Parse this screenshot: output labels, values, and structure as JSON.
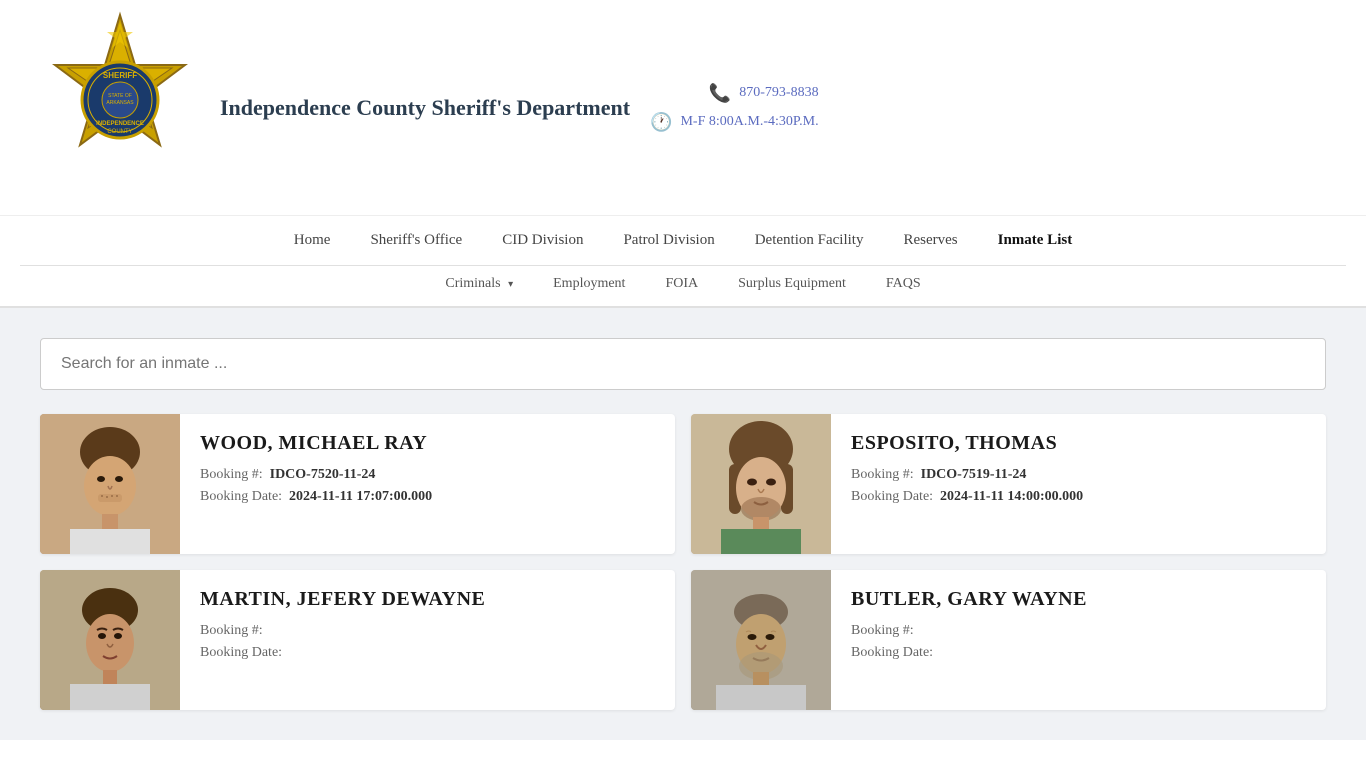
{
  "header": {
    "title": "Independence County Sheriff's Department",
    "phone": "870-793-8838",
    "hours": "M-F 8:00A.M.-4:30P.M."
  },
  "nav": {
    "primary": [
      {
        "label": "Home",
        "active": false
      },
      {
        "label": "Sheriff's Office",
        "active": false
      },
      {
        "label": "CID Division",
        "active": false
      },
      {
        "label": "Patrol Division",
        "active": false
      },
      {
        "label": "Detention Facility",
        "active": false
      },
      {
        "label": "Reserves",
        "active": false
      },
      {
        "label": "Inmate List",
        "active": true
      }
    ],
    "secondary": [
      {
        "label": "Criminals",
        "hasDropdown": true
      },
      {
        "label": "Employment",
        "hasDropdown": false
      },
      {
        "label": "FOIA",
        "hasDropdown": false
      },
      {
        "label": "Surplus Equipment",
        "hasDropdown": false
      },
      {
        "label": "FAQS",
        "hasDropdown": false
      }
    ]
  },
  "search": {
    "placeholder": "Search for an inmate ..."
  },
  "inmates": [
    {
      "name": "WOOD, MICHAEL RAY",
      "booking_num": "IDCO-7520-11-24",
      "booking_date": "2024-11-11 17:07:00.000",
      "booking_label": "Booking #:",
      "date_label": "Booking Date:"
    },
    {
      "name": "ESPOSITO, THOMAS",
      "booking_num": "IDCO-7519-11-24",
      "booking_date": "2024-11-11 14:00:00.000",
      "booking_label": "Booking #:",
      "date_label": "Booking Date:"
    },
    {
      "name": "MARTIN, JEFERY DEWAYNE",
      "booking_num": "",
      "booking_date": "",
      "booking_label": "Booking #:",
      "date_label": "Booking Date:"
    },
    {
      "name": "BUTLER, GARY WAYNE",
      "booking_num": "",
      "booking_date": "",
      "booking_label": "Booking #:",
      "date_label": "Booking Date:"
    }
  ]
}
